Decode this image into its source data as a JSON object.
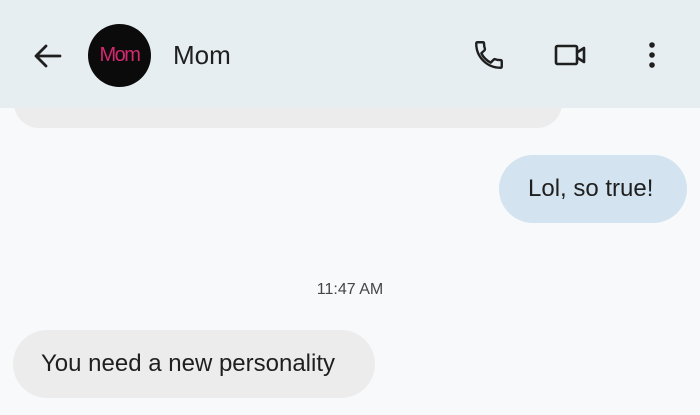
{
  "header": {
    "back_icon": "arrow-left-icon",
    "avatar_text": "Mom",
    "contact_name": "Mom",
    "call_icon": "phone-icon",
    "video_icon": "video-camera-icon",
    "more_icon": "more-vertical-icon",
    "background_color": "#e7eef1",
    "avatar_text_color": "#d4286f"
  },
  "conversation": {
    "messages_before": [
      {
        "direction": "outgoing",
        "text": "Lol, so true!",
        "bubble_color": "#d3e3f0"
      }
    ],
    "timestamp": "11:47 AM",
    "messages_after": [
      {
        "direction": "incoming",
        "text": "You need a new personality",
        "bubble_color": "#ececec"
      }
    ]
  }
}
